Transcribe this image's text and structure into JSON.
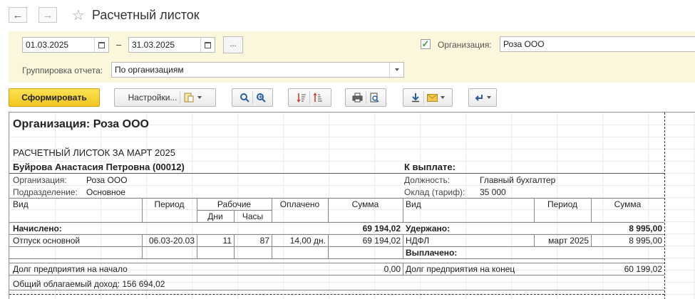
{
  "window": {
    "title": "Расчетный листок",
    "back_icon": "←",
    "forward_icon": "→",
    "star_icon": "☆"
  },
  "filters": {
    "date_from": "01.03.2025",
    "dash": "–",
    "date_to": "31.03.2025",
    "period_button": "...",
    "org_checked": true,
    "org_label": "Организация:",
    "org_value": "Роза ООО",
    "grouping_label": "Группировка отчета:",
    "grouping_value": "По организациям"
  },
  "toolbar": {
    "generate_label": "Сформировать",
    "settings_label": "Настройки..."
  },
  "report": {
    "org_heading": "Организация: Роза ООО",
    "sheet_title": "РАСЧЕТНЫЙ ЛИСТОК ЗА МАРТ 2025",
    "employee": "Буйрова Анастасия Петровна (00012)",
    "to_pay_label": "К выплате:",
    "org_label": "Организация:",
    "org_value": "Роза ООО",
    "dept_label": "Подразделение:",
    "dept_value": "Основное",
    "position_label": "Должность:",
    "position_value": "Главный бухгалтер",
    "salary_label": "Оклад (тариф):",
    "salary_value": "35 000",
    "headers": {
      "kind": "Вид",
      "period": "Период",
      "working": "Рабочие",
      "days": "Дни",
      "hours": "Часы",
      "paid": "Оплачено",
      "sum": "Сумма",
      "kind2": "Вид",
      "period2": "Период",
      "sum2": "Сумма"
    },
    "accrued_label": "Начислено:",
    "accrued_total": "69 194,02",
    "withheld_label": "Удержано:",
    "withheld_total": "8 995,00",
    "accrual_row": {
      "kind": "Отпуск основной",
      "period": "06.03-20.03",
      "days": "11",
      "hours": "87",
      "paid": "14,00 дн.",
      "sum": "69 194,02"
    },
    "withholding_row": {
      "kind": "НДФЛ",
      "period": "март 2025",
      "sum": "8 995,00"
    },
    "paid_out_label": "Выплачено:",
    "debt_start_label": "Долг предприятия на начало",
    "debt_start_value": "0,00",
    "debt_end_label": "Долг предприятия на конец",
    "debt_end_value": "60 199,02",
    "taxable_income": "Общий облагаемый доход: 156 694,02"
  }
}
